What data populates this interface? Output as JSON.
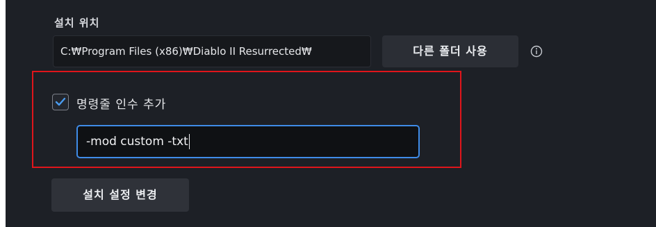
{
  "install_location": {
    "label": "설치 위치",
    "path": "C:₩Program Files (x86)₩Diablo II Resurrected₩",
    "other_folder_button": "다른 폴더 사용",
    "info_icon": "info-circle-icon"
  },
  "command_line": {
    "checkbox_label": "명령줄 인수 추가",
    "checked": true,
    "arguments_value": "-mod custom -txt"
  },
  "change_settings_button": "설치 설정 변경",
  "colors": {
    "background": "#1d2026",
    "highlight": "#e0151b",
    "focus_border": "#3f8ce8",
    "check_accent": "#4a9cf0"
  }
}
